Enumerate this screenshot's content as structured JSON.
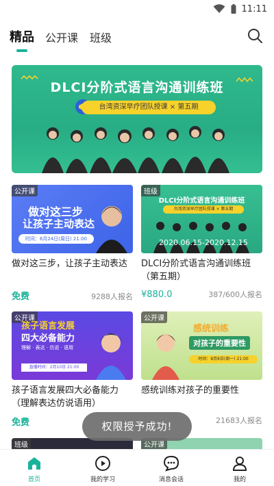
{
  "status_bar": {
    "time": "11:11"
  },
  "top_tabs": [
    {
      "label": "精品",
      "active": true
    },
    {
      "label": "公开课",
      "active": false
    },
    {
      "label": "班级",
      "active": false
    }
  ],
  "banner": {
    "title": "DLCI分阶式语言沟通训练班",
    "pill": "台湾资深早疗团队授课 × 第五期"
  },
  "courses": [
    {
      "tag": "公开课",
      "thumb_lines": [
        "做对这三步",
        "让孩子主动表达"
      ],
      "thumb_sub": "时间：6月24日(周日) 21:00",
      "title": "做对这三步，让孩子主动表达",
      "price": "免费",
      "count": "9288人报名"
    },
    {
      "tag": "班级",
      "thumb_lines": [
        "DLCI分阶式语言沟通训练班"
      ],
      "thumb_sub": "台湾资深早疗团队授课 × 第五期",
      "thumb_date": "2020.06.15-2020.12.15",
      "title": "DLCI分阶式语言沟通训练班（第五期）",
      "price": "¥880.0",
      "count": "387/600人报名"
    },
    {
      "tag": "公开课",
      "thumb_lines": [
        "孩子语言发展",
        "四大必备能力"
      ],
      "thumb_sub": "理解 · 表达 · 仿说 · 语用",
      "thumb_sub2": "直播时间：2月10日 21:00",
      "title": "孩子语言发展四大必备能力（理解表达仿说语用）",
      "price": "免费",
      "count": ""
    },
    {
      "tag": "公开课",
      "thumb_lines": [
        "感统训练",
        "对孩子的重要性"
      ],
      "thumb_sub": "时间：8月8日(周一) 21:00",
      "title": "感统训练对孩子的重要性",
      "price": "",
      "count": "21683人报名"
    }
  ],
  "partial_tags": [
    "班级",
    "公开课"
  ],
  "toast": "权限授予成功!",
  "bottom_nav": [
    {
      "label": "首页",
      "icon": "home-icon",
      "active": true
    },
    {
      "label": "我的学习",
      "icon": "play-icon",
      "active": false
    },
    {
      "label": "消息会话",
      "icon": "chat-icon",
      "active": false
    },
    {
      "label": "我的",
      "icon": "user-icon",
      "active": false
    }
  ],
  "colors": {
    "accent": "#19b39a",
    "banner": "#2fb98d",
    "toast": "#6e6e6e"
  }
}
